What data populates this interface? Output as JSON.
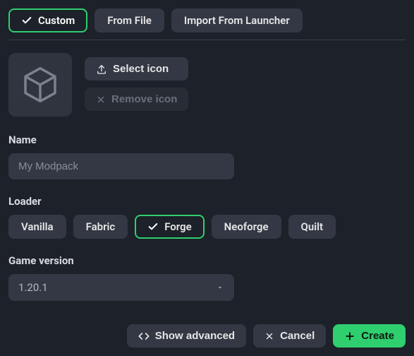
{
  "tabs": {
    "custom": "Custom",
    "from_file": "From File",
    "import_launcher": "Import From Launcher"
  },
  "icon": {
    "select": "Select icon",
    "remove": "Remove icon"
  },
  "name": {
    "label": "Name",
    "placeholder": "My Modpack",
    "value": ""
  },
  "loader": {
    "label": "Loader",
    "options": {
      "vanilla": "Vanilla",
      "fabric": "Fabric",
      "forge": "Forge",
      "neoforge": "Neoforge",
      "quilt": "Quilt"
    }
  },
  "version": {
    "label": "Game version",
    "value": "1.20.1"
  },
  "footer": {
    "show_advanced": "Show advanced",
    "cancel": "Cancel",
    "create": "Create"
  }
}
